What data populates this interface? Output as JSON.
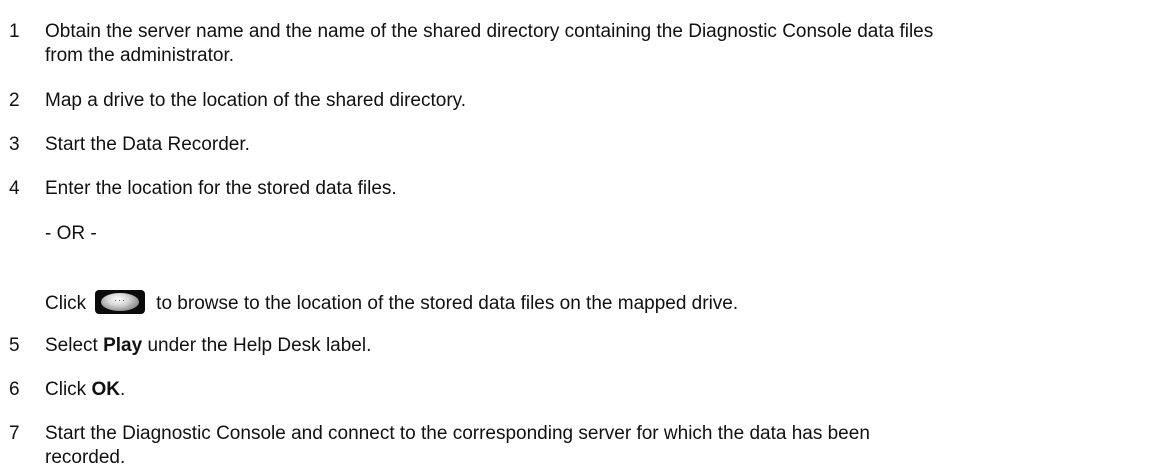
{
  "steps": [
    {
      "num": "1",
      "text": "Obtain the server name and the name of the shared directory containing the Diagnostic Console data files",
      "text_cont": "from the administrator."
    },
    {
      "num": "2",
      "text": "Map a drive to the location of the shared directory."
    },
    {
      "num": "3",
      "text": "Start the Data Recorder."
    },
    {
      "num": "4",
      "text": "Enter the location for the stored data files.",
      "or": "- OR -",
      "click_prefix": "Click",
      "click_suffix": "to browse to the location of the stored data files on the mapped drive."
    },
    {
      "num": "5",
      "pre": "Select ",
      "bold": "Play",
      "post": " under the Help Desk label."
    },
    {
      "num": "6",
      "pre": "Click ",
      "bold": "OK",
      "post": "."
    },
    {
      "num": "7",
      "text": "Start the Diagnostic Console and connect to the corresponding server for which the data has been",
      "text_cont": "recorded."
    }
  ],
  "browse_button": {
    "icon": "ellipsis-browse-icon",
    "glyph": "···"
  }
}
